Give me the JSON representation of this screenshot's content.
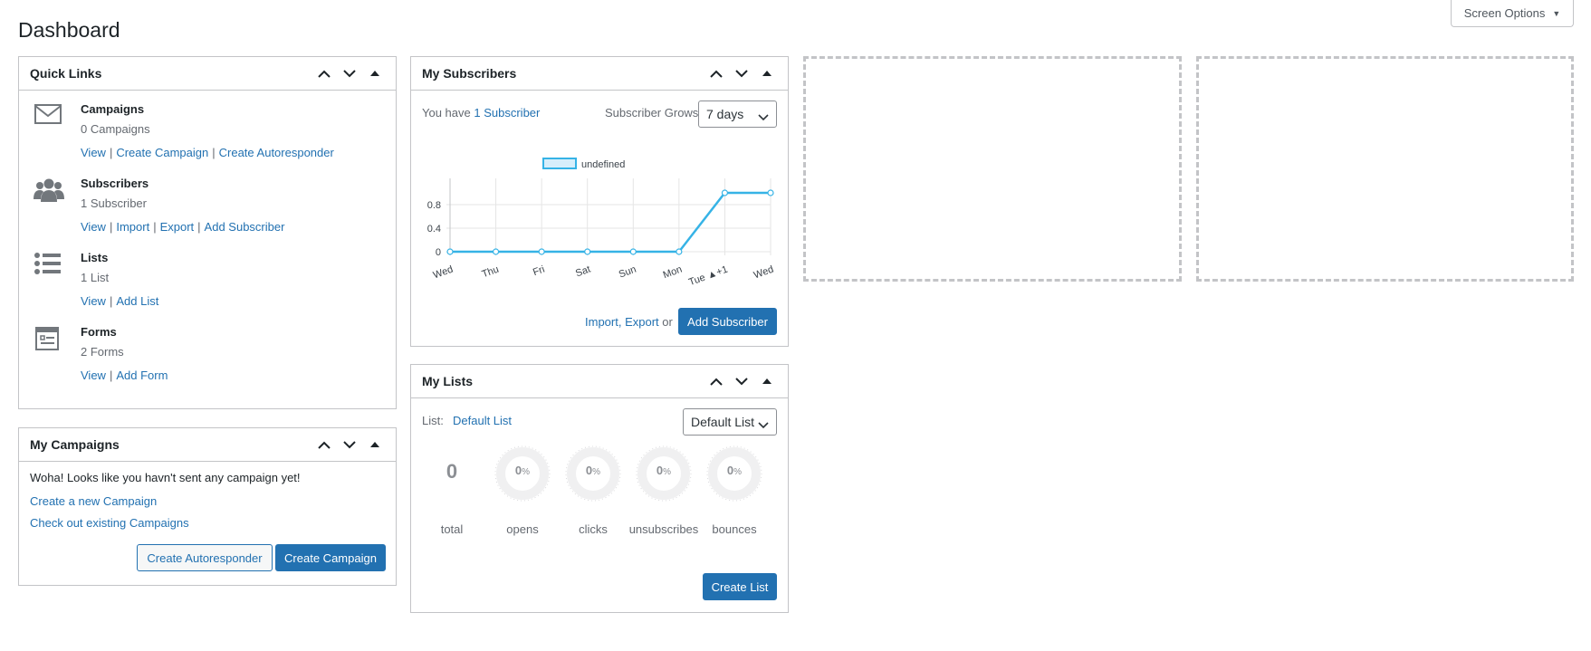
{
  "page": {
    "title": "Dashboard",
    "screen_options": "Screen Options"
  },
  "quick_links": {
    "title": "Quick Links",
    "items": [
      {
        "icon": "envelope-icon",
        "title": "Campaigns",
        "count": "0 Campaigns",
        "links": [
          "View",
          "Create Campaign",
          "Create Autoresponder"
        ]
      },
      {
        "icon": "users-icon",
        "title": "Subscribers",
        "count": "1 Subscriber",
        "links": [
          "View",
          "Import",
          "Export",
          "Add Subscriber"
        ]
      },
      {
        "icon": "list-icon",
        "title": "Lists",
        "count": "1 List",
        "links": [
          "View",
          "Add List"
        ]
      },
      {
        "icon": "form-icon",
        "title": "Forms",
        "count": "2 Forms",
        "links": [
          "View",
          "Add Form"
        ]
      }
    ]
  },
  "my_campaigns": {
    "title": "My Campaigns",
    "message": "Woha! Looks like you havn't sent any campaign yet!",
    "link_new": "Create a new Campaign",
    "link_existing": "Check out existing Campaigns",
    "btn_autoresponder": "Create Autoresponder",
    "btn_campaign": "Create Campaign"
  },
  "my_subscribers": {
    "title": "My Subscribers",
    "you_have": "You have",
    "subscriber_link": "1 Subscriber",
    "grows_label": "Subscriber Grows:",
    "grows_value": "7 days",
    "import_export": "Import, Export",
    "or": "or",
    "add_button": "Add Subscriber"
  },
  "chart_data": {
    "type": "line",
    "legend": [
      "undefined"
    ],
    "categories": [
      "Wed",
      "Thu",
      "Fri",
      "Sat",
      "Sun",
      "Mon",
      "Tue ▲+1",
      "Wed"
    ],
    "series": [
      {
        "name": "undefined",
        "values": [
          0,
          0,
          0,
          0,
          0,
          0,
          1,
          1
        ]
      }
    ],
    "yticks": [
      "0",
      "0.4",
      "0.8"
    ],
    "ylim": [
      0,
      1
    ],
    "color": "#36b3e6",
    "fill": "#d7eefb"
  },
  "my_lists": {
    "title": "My Lists",
    "list_label": "List:",
    "list_name": "Default List",
    "select_value": "Default List",
    "total": "0",
    "total_label": "total",
    "rings": [
      {
        "value": "0",
        "unit": "%",
        "label": "opens"
      },
      {
        "value": "0",
        "unit": "%",
        "label": "clicks"
      },
      {
        "value": "0",
        "unit": "%",
        "label": "unsubscribes"
      },
      {
        "value": "0",
        "unit": "%",
        "label": "bounces"
      }
    ],
    "create_button": "Create List"
  }
}
